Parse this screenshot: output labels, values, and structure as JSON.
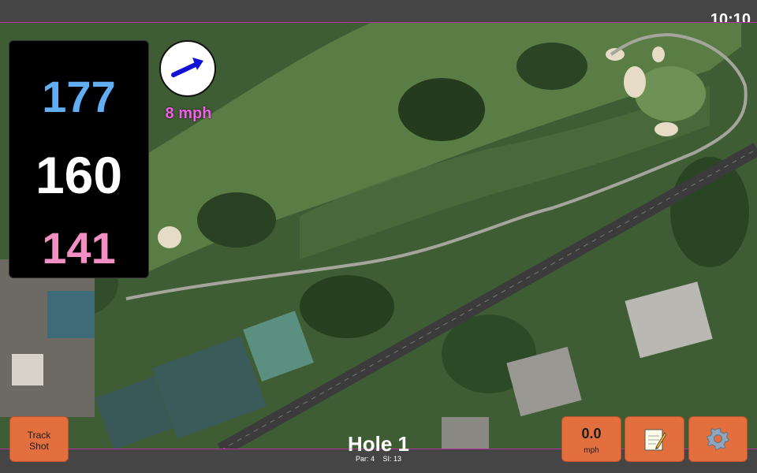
{
  "status_bar": {
    "time": "10:10"
  },
  "distances": {
    "back": "177",
    "center": "160",
    "front": "141"
  },
  "wind": {
    "speed_label": "8 mph",
    "direction": "arrow-northeast"
  },
  "buttons": {
    "track_shot": {
      "line1": "Track",
      "line2": "Shot"
    },
    "wind_readout": {
      "value": "0.0",
      "unit": "mph"
    },
    "scorecard_icon": "notepad-icon",
    "settings_icon": "gear-icon"
  },
  "hole": {
    "title": "Hole 1",
    "par": "Par: 4",
    "si": "SI: 13"
  },
  "colors": {
    "back": "#62aef5",
    "center": "#ffffff",
    "front": "#f48fc4",
    "wind_text": "#f061e6",
    "button": "#e36f3e",
    "map_border": "#b7339a"
  }
}
